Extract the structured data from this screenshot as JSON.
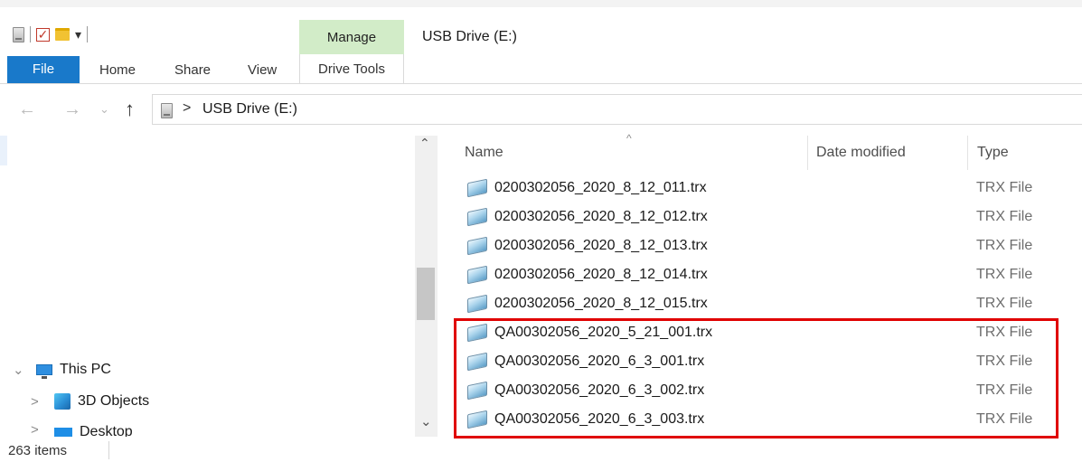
{
  "window": {
    "title": "USB Drive (E:)"
  },
  "ribbon": {
    "context_tab": "Manage",
    "tabs": [
      "File",
      "Home",
      "Share",
      "View"
    ],
    "context_subtab": "Drive Tools"
  },
  "quick_access": {
    "dropdown": "▾"
  },
  "navigation": {
    "back_glyph": "←",
    "forward_glyph": "→",
    "recent_glyph": "⌄",
    "up_glyph": "↑",
    "breadcrumb_chevron": ">",
    "address": "USB Drive (E:)"
  },
  "nav_pane": {
    "items": [
      {
        "label": "This PC",
        "expand": "⌄",
        "icon": "pc-icon"
      },
      {
        "label": "3D Objects",
        "expand": ">",
        "icon": "3d-objects-icon"
      },
      {
        "label": "Desktop",
        "expand": ">",
        "icon": "desktop-icon"
      }
    ],
    "scroll_up": "⌃",
    "scroll_down": "⌄"
  },
  "file_list": {
    "sort_indicator": "^",
    "columns": [
      "Name",
      "Date modified",
      "Type"
    ],
    "files": [
      {
        "name": "0200302056_2020_8_12_011.trx",
        "type": "TRX File"
      },
      {
        "name": "0200302056_2020_8_12_012.trx",
        "type": "TRX File"
      },
      {
        "name": "0200302056_2020_8_12_013.trx",
        "type": "TRX File"
      },
      {
        "name": "0200302056_2020_8_12_014.trx",
        "type": "TRX File"
      },
      {
        "name": "0200302056_2020_8_12_015.trx",
        "type": "TRX File"
      },
      {
        "name": "QA00302056_2020_5_21_001.trx",
        "type": "TRX File"
      },
      {
        "name": "QA00302056_2020_6_3_001.trx",
        "type": "TRX File"
      },
      {
        "name": "QA00302056_2020_6_3_002.trx",
        "type": "TRX File"
      },
      {
        "name": "QA00302056_2020_6_3_003.trx",
        "type": "TRX File"
      }
    ],
    "highlighted_files": [
      5,
      6,
      7,
      8
    ]
  },
  "status_bar": {
    "item_count": "263 items"
  },
  "colors": {
    "file_tab": "#1979ca",
    "manage_tab": "#d2ecc8",
    "highlight_border": "#e00000"
  }
}
